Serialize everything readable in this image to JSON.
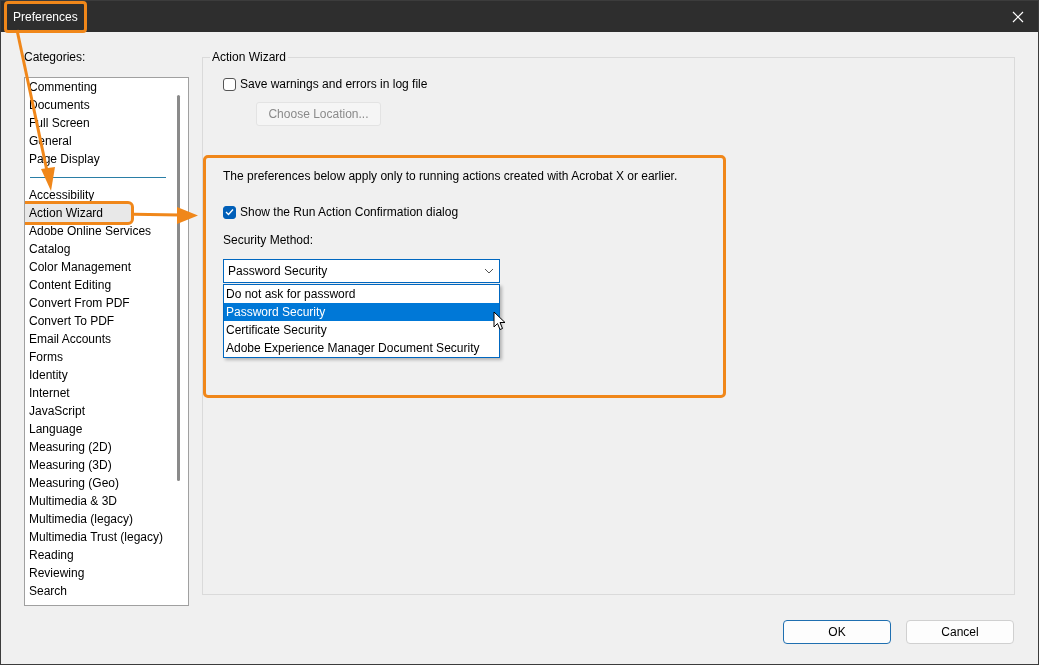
{
  "window": {
    "title": "Preferences",
    "highlighted": true
  },
  "categories": {
    "label": "Categories:",
    "items": [
      {
        "kind": "item",
        "label": "Commenting",
        "selected": false,
        "highlighted": false
      },
      {
        "kind": "item",
        "label": "Documents",
        "selected": false,
        "highlighted": false
      },
      {
        "kind": "item",
        "label": "Full Screen",
        "selected": false,
        "highlighted": false
      },
      {
        "kind": "item",
        "label": "General",
        "selected": false,
        "highlighted": false
      },
      {
        "kind": "item",
        "label": "Page Display",
        "selected": false,
        "highlighted": false
      },
      {
        "kind": "separator"
      },
      {
        "kind": "item",
        "label": "Accessibility",
        "selected": false,
        "highlighted": false
      },
      {
        "kind": "item",
        "label": "Action Wizard",
        "selected": true,
        "highlighted": true
      },
      {
        "kind": "item",
        "label": "Adobe Online Services",
        "selected": false,
        "highlighted": false
      },
      {
        "kind": "item",
        "label": "Catalog",
        "selected": false,
        "highlighted": false
      },
      {
        "kind": "item",
        "label": "Color Management",
        "selected": false,
        "highlighted": false
      },
      {
        "kind": "item",
        "label": "Content Editing",
        "selected": false,
        "highlighted": false
      },
      {
        "kind": "item",
        "label": "Convert From PDF",
        "selected": false,
        "highlighted": false
      },
      {
        "kind": "item",
        "label": "Convert To PDF",
        "selected": false,
        "highlighted": false
      },
      {
        "kind": "item",
        "label": "Email Accounts",
        "selected": false,
        "highlighted": false
      },
      {
        "kind": "item",
        "label": "Forms",
        "selected": false,
        "highlighted": false
      },
      {
        "kind": "item",
        "label": "Identity",
        "selected": false,
        "highlighted": false
      },
      {
        "kind": "item",
        "label": "Internet",
        "selected": false,
        "highlighted": false
      },
      {
        "kind": "item",
        "label": "JavaScript",
        "selected": false,
        "highlighted": false
      },
      {
        "kind": "item",
        "label": "Language",
        "selected": false,
        "highlighted": false
      },
      {
        "kind": "item",
        "label": "Measuring (2D)",
        "selected": false,
        "highlighted": false
      },
      {
        "kind": "item",
        "label": "Measuring (3D)",
        "selected": false,
        "highlighted": false
      },
      {
        "kind": "item",
        "label": "Measuring (Geo)",
        "selected": false,
        "highlighted": false
      },
      {
        "kind": "item",
        "label": "Multimedia & 3D",
        "selected": false,
        "highlighted": false
      },
      {
        "kind": "item",
        "label": "Multimedia (legacy)",
        "selected": false,
        "highlighted": false
      },
      {
        "kind": "item",
        "label": "Multimedia Trust (legacy)",
        "selected": false,
        "highlighted": false
      },
      {
        "kind": "item",
        "label": "Reading",
        "selected": false,
        "highlighted": false
      },
      {
        "kind": "item",
        "label": "Reviewing",
        "selected": false,
        "highlighted": false
      },
      {
        "kind": "item",
        "label": "Search",
        "selected": false,
        "highlighted": false
      }
    ]
  },
  "group": {
    "title": "Action Wizard",
    "log_checkbox": {
      "label": "Save warnings and errors in log file",
      "checked": false
    },
    "choose_button": {
      "label": "Choose Location...",
      "disabled": true
    },
    "section": {
      "highlighted": true,
      "note": "The preferences below apply only to running actions created with Acrobat X or earlier.",
      "confirm_checkbox": {
        "label": "Show the Run Action Confirmation dialog",
        "checked": true
      },
      "security_label": "Security Method:",
      "security_select": {
        "value": "Password Security",
        "open": true,
        "options": [
          {
            "label": "Do not ask for password",
            "selected": false
          },
          {
            "label": "Password Security",
            "selected": true
          },
          {
            "label": "Certificate Security",
            "selected": false
          },
          {
            "label": "Adobe Experience Manager Document Security",
            "selected": false
          }
        ]
      }
    }
  },
  "buttons": [
    {
      "label": "OK",
      "default": true
    },
    {
      "label": "Cancel",
      "default": false
    }
  ]
}
